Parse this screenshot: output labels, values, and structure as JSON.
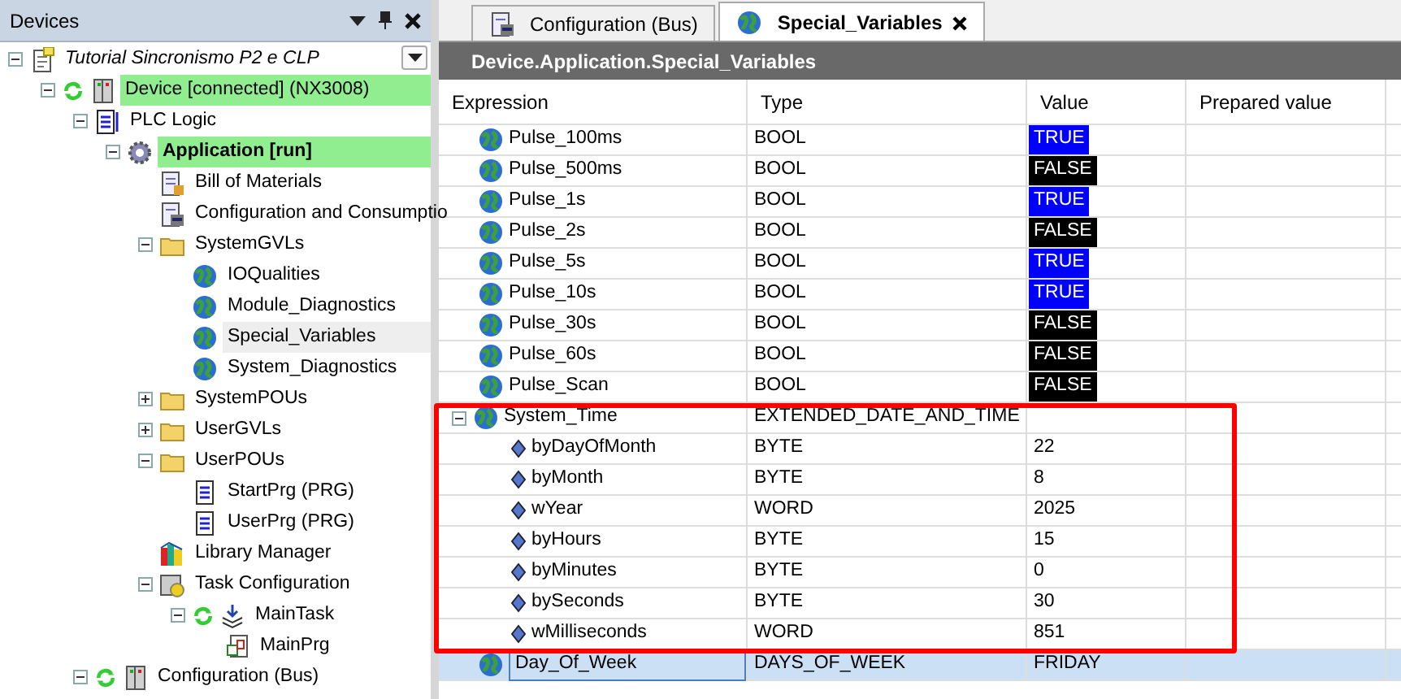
{
  "devices_panel": {
    "title": "Devices",
    "tree": [
      {
        "label": "Tutorial Sincronismo P2 e CLP",
        "kind": "project",
        "expanded": true,
        "children": [
          {
            "label": "Device [connected] (NX3008)",
            "kind": "device",
            "expanded": true,
            "highlighted": true,
            "children": [
              {
                "label": "PLC Logic",
                "kind": "plc",
                "expanded": true,
                "children": [
                  {
                    "label": "Application [run]",
                    "kind": "application",
                    "expanded": true,
                    "highlighted": true,
                    "bold": true,
                    "children": [
                      {
                        "label": "Bill of Materials",
                        "kind": "bom"
                      },
                      {
                        "label": "Configuration and Consumptio",
                        "kind": "config"
                      },
                      {
                        "label": "SystemGVLs",
                        "kind": "folder",
                        "expanded": true,
                        "children": [
                          {
                            "label": "IOQualities",
                            "kind": "gvl"
                          },
                          {
                            "label": "Module_Diagnostics",
                            "kind": "gvl"
                          },
                          {
                            "label": "Special_Variables",
                            "kind": "gvl",
                            "selected": true
                          },
                          {
                            "label": "System_Diagnostics",
                            "kind": "gvl"
                          }
                        ]
                      },
                      {
                        "label": "SystemPOUs",
                        "kind": "folder",
                        "expanded": false
                      },
                      {
                        "label": "UserGVLs",
                        "kind": "folder",
                        "expanded": false
                      },
                      {
                        "label": "UserPOUs",
                        "kind": "folder",
                        "expanded": true,
                        "children": [
                          {
                            "label": "StartPrg (PRG)",
                            "kind": "pou"
                          },
                          {
                            "label": "UserPrg (PRG)",
                            "kind": "pou"
                          }
                        ]
                      },
                      {
                        "label": "Library Manager",
                        "kind": "library"
                      },
                      {
                        "label": "Task Configuration",
                        "kind": "taskconfig",
                        "expanded": true,
                        "children": [
                          {
                            "label": "MainTask",
                            "kind": "task",
                            "expanded": true,
                            "children": [
                              {
                                "label": "MainPrg",
                                "kind": "call"
                              }
                            ]
                          }
                        ]
                      }
                    ]
                  }
                ]
              },
              {
                "label": "Configuration (Bus)",
                "kind": "device",
                "expanded": true
              }
            ]
          }
        ]
      }
    ]
  },
  "tabs": [
    {
      "label": "Configuration (Bus)",
      "kind": "config",
      "selected": false
    },
    {
      "label": "Special_Variables",
      "kind": "gvl",
      "selected": true,
      "closable": true
    }
  ],
  "watch": {
    "title": "Device.Application.Special_Variables",
    "columns": [
      "Expression",
      "Type",
      "Value",
      "Prepared value"
    ],
    "rows": [
      {
        "kind": "bool",
        "expression": "Pulse_100ms",
        "type": "BOOL",
        "value": "TRUE",
        "on": true
      },
      {
        "kind": "bool",
        "expression": "Pulse_500ms",
        "type": "BOOL",
        "value": "FALSE",
        "on": false
      },
      {
        "kind": "bool",
        "expression": "Pulse_1s",
        "type": "BOOL",
        "value": "TRUE",
        "on": true
      },
      {
        "kind": "bool",
        "expression": "Pulse_2s",
        "type": "BOOL",
        "value": "FALSE",
        "on": false
      },
      {
        "kind": "bool",
        "expression": "Pulse_5s",
        "type": "BOOL",
        "value": "TRUE",
        "on": true
      },
      {
        "kind": "bool",
        "expression": "Pulse_10s",
        "type": "BOOL",
        "value": "TRUE",
        "on": true
      },
      {
        "kind": "bool",
        "expression": "Pulse_30s",
        "type": "BOOL",
        "value": "FALSE",
        "on": false
      },
      {
        "kind": "bool",
        "expression": "Pulse_60s",
        "type": "BOOL",
        "value": "FALSE",
        "on": false
      },
      {
        "kind": "bool",
        "expression": "Pulse_Scan",
        "type": "BOOL",
        "value": "FALSE",
        "on": false
      },
      {
        "kind": "struct",
        "expression": "System_Time",
        "type": "EXTENDED_DATE_AND_TIME",
        "expanded": true,
        "annotated": true,
        "children": [
          {
            "expression": "byDayOfMonth",
            "type": "BYTE",
            "value": "22"
          },
          {
            "expression": "byMonth",
            "type": "BYTE",
            "value": "8"
          },
          {
            "expression": "wYear",
            "type": "WORD",
            "value": "2025"
          },
          {
            "expression": "byHours",
            "type": "BYTE",
            "value": "15"
          },
          {
            "expression": "byMinutes",
            "type": "BYTE",
            "value": "0"
          },
          {
            "expression": "bySeconds",
            "type": "BYTE",
            "value": "30"
          },
          {
            "expression": "wMilliseconds",
            "type": "WORD",
            "value": "851"
          }
        ]
      },
      {
        "kind": "enum",
        "expression": "Day_Of_Week",
        "type": "DAYS_OF_WEEK",
        "value": "FRIDAY",
        "selected": true
      }
    ]
  }
}
